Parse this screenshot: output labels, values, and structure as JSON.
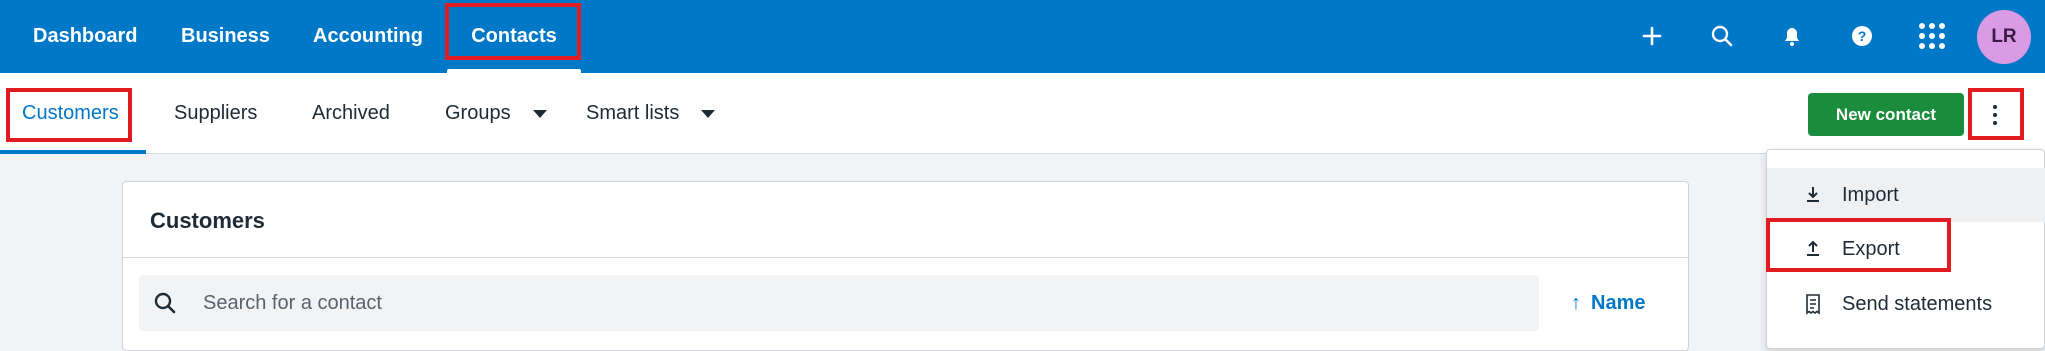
{
  "topnav": {
    "items": [
      {
        "label": "Dashboard"
      },
      {
        "label": "Business"
      },
      {
        "label": "Accounting"
      },
      {
        "label": "Contacts"
      }
    ],
    "icons": [
      "plus-icon",
      "search-icon",
      "bell-icon",
      "help-icon",
      "apps-grid-icon"
    ],
    "avatar": "LR",
    "colors": {
      "bar": "#0078c8",
      "avatar_bg": "#d99be3"
    }
  },
  "subnav": {
    "tabs": [
      {
        "label": "Customers"
      },
      {
        "label": "Suppliers"
      },
      {
        "label": "Archived"
      },
      {
        "label": "Groups"
      },
      {
        "label": "Smart lists"
      }
    ],
    "new_contact_label": "New contact",
    "colors": {
      "accent": "#0078c8",
      "primary_button": "#1b8c3c"
    }
  },
  "card": {
    "title": "Customers",
    "search_placeholder": "Search for a contact",
    "sort_label": "Name",
    "sort_icon": "arrow-up-icon"
  },
  "menu": {
    "items": [
      {
        "label": "Import",
        "icon": "import-icon"
      },
      {
        "label": "Export",
        "icon": "export-icon"
      },
      {
        "label": "Send statements",
        "icon": "receipt-icon"
      }
    ]
  },
  "annotation_color": "#e21b23"
}
